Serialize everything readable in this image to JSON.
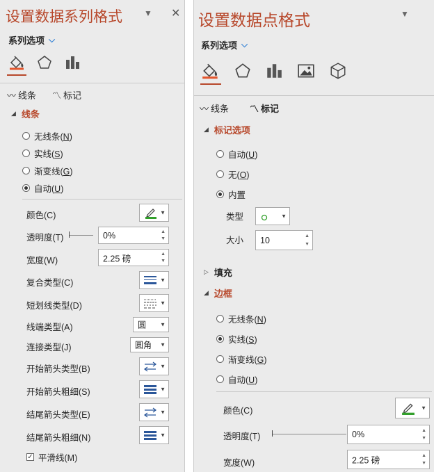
{
  "left": {
    "title": "设置数据系列格式",
    "series_options": "系列选项",
    "tabs": {
      "line": "线条",
      "marker": "标记"
    },
    "section": "线条",
    "radios": [
      {
        "label": "无线条(",
        "key": "N",
        "end": ")",
        "selected": false
      },
      {
        "label": "实线(",
        "key": "S",
        "end": ")",
        "selected": false
      },
      {
        "label": "渐变线(",
        "key": "G",
        "end": ")",
        "selected": false
      },
      {
        "label": "自动(",
        "key": "U",
        "end": ")",
        "selected": true
      }
    ],
    "color_label": "颜色(C)",
    "transparency_label": "透明度(T)",
    "transparency_value": "0%",
    "width_label": "宽度(W)",
    "width_value": "2.25 磅",
    "compound_label": "复合类型(C)",
    "dash_label": "短划线类型(D)",
    "cap_label": "线端类型(A)",
    "cap_value": "圆",
    "join_label": "连接类型(J)",
    "join_value": "圆角",
    "begin_arrow_type_label": "开始箭头类型(B)",
    "begin_arrow_size_label": "开始箭头粗细(S)",
    "end_arrow_type_label": "结尾箭头类型(E)",
    "end_arrow_size_label": "结尾箭头粗细(N)",
    "smooth_label": "平滑线(M)",
    "smooth_checked": true
  },
  "right": {
    "title": "设置数据点格式",
    "series_options": "系列选项",
    "tabs": {
      "line": "线条",
      "marker": "标记"
    },
    "marker_section": "标记选项",
    "marker_radios": [
      {
        "label": "自动(",
        "key": "U",
        "end": ")",
        "selected": false
      },
      {
        "label": "无(",
        "key": "O",
        "end": ")",
        "selected": false
      },
      {
        "label": "内置",
        "key": "",
        "end": "",
        "selected": true
      }
    ],
    "type_label": "类型",
    "size_label": "大小",
    "size_value": "10",
    "fill_section": "填充",
    "border_section": "边框",
    "border_radios": [
      {
        "label": "无线条(",
        "key": "N",
        "end": ")",
        "selected": false
      },
      {
        "label": "实线(",
        "key": "S",
        "end": ")",
        "selected": true
      },
      {
        "label": "渐变线(",
        "key": "G",
        "end": ")",
        "selected": false
      },
      {
        "label": "自动(",
        "key": "U",
        "end": ")",
        "selected": false
      }
    ],
    "color_label": "颜色(C)",
    "transparency_label": "透明度(T)",
    "transparency_value": "0%",
    "width_label": "宽度(W)",
    "width_value": "2.25 磅"
  },
  "colors": {
    "accent": "#b7472a",
    "pane_bg": "#ebebeb",
    "marker_green": "#33a02c"
  }
}
